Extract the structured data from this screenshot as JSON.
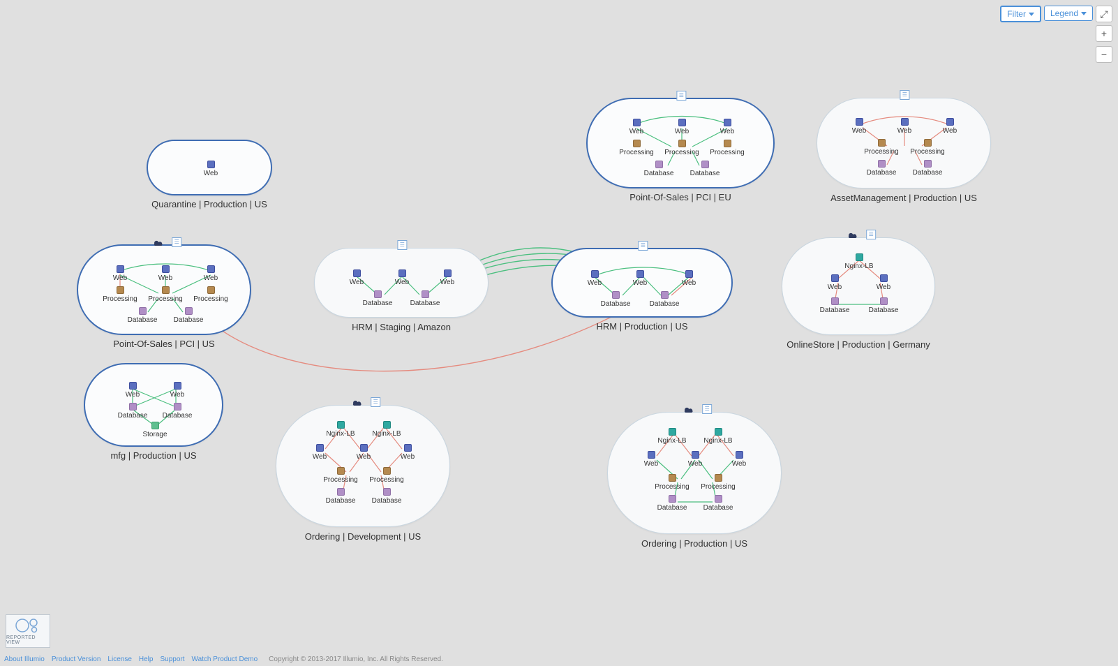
{
  "controls": {
    "filter": "Filter",
    "legend": "Legend",
    "fullscreen": "⤢",
    "zoom_in": "+",
    "zoom_out": "−"
  },
  "colors": {
    "web": "#5b6fbf",
    "processing": "#b5894f",
    "database": "#b08fc6",
    "storage": "#5fbf8f",
    "lb": "#2fa8a0",
    "edge_green": "#4bbf7f",
    "edge_red": "#e58b7f",
    "bubble_border_blue": "#3f6db3"
  },
  "node_labels": {
    "web": "Web",
    "processing": "Processing",
    "database": "Database",
    "storage": "Storage",
    "nginx_lb": "Nginx-LB"
  },
  "groups": {
    "quarantine": {
      "label": "Quarantine | Production | US"
    },
    "pos_eu": {
      "label": "Point-Of-Sales | PCI | EU"
    },
    "asset_mgmt": {
      "label": "AssetManagement | Production | US"
    },
    "pos_us": {
      "label": "Point-Of-Sales | PCI | US"
    },
    "hrm_stg": {
      "label": "HRM | Staging | Amazon"
    },
    "hrm_prod": {
      "label": "HRM | Production | US"
    },
    "onlinestore": {
      "label": "OnlineStore | Production | Germany"
    },
    "mfg": {
      "label": "mfg | Production | US"
    },
    "ordering_dev": {
      "label": "Ordering | Development | US"
    },
    "ordering_prod": {
      "label": "Ordering | Production | US"
    }
  },
  "badge": {
    "label": "REPORTED VIEW"
  },
  "footer": {
    "links": [
      "About Illumio",
      "Product Version",
      "License",
      "Help",
      "Support",
      "Watch Product Demo"
    ],
    "copyright": "Copyright © 2013-2017 Illumio, Inc. All Rights Reserved."
  }
}
